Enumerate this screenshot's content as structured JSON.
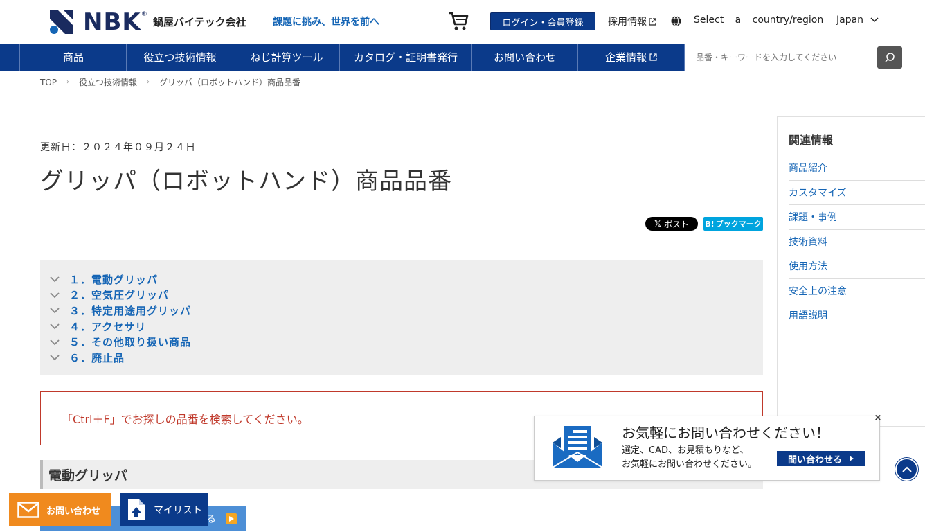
{
  "header": {
    "brand": "NBK",
    "company": "鍋屋バイテック会社",
    "tagline": "課題に挑み、世界を前へ",
    "login_label": "ログイン・会員登録",
    "recruit_label": "採用情報",
    "country_prompt": "Select a country/region",
    "country_value": "Japan"
  },
  "nav": {
    "items": [
      {
        "label": "商品"
      },
      {
        "label": "役立つ技術情報"
      },
      {
        "label": "ねじ計算ツール"
      },
      {
        "label": "カタログ・証明書発行"
      },
      {
        "label": "お問い合わせ"
      },
      {
        "label": "企業情報"
      }
    ],
    "search_placeholder": "品番・キーワードを入力してください"
  },
  "breadcrumb": [
    "TOP",
    "役立つ技術情報",
    "グリッパ（ロボットハンド）商品品番"
  ],
  "main": {
    "updated": "更新日：２０２４年０９月２４日",
    "title": "グリッパ（ロボットハンド）商品品番",
    "share_x": "ポスト",
    "share_hatena": "ブックマーク",
    "toc": [
      "１．電動グリッパ",
      "２．空気圧グリッパ",
      "３．特定用途用グリッパ",
      "４．アクセサリ",
      "５．その他取り扱い商品",
      "６．廃止品"
    ],
    "notice": "「Ctrl＋F」でお探しの品番を検索してください。",
    "section_title": "電動グリッパ",
    "section_link": "る"
  },
  "sidebar": {
    "title": "関連情報",
    "items": [
      "商品紹介",
      "カスタマイズ",
      "課題・事例",
      "技術資料",
      "使用方法",
      "安全上の注意",
      "用語説明"
    ]
  },
  "popup": {
    "title": "お気軽にお問い合わせください！",
    "body_line1": "選定、CAD、お見積もりなど、",
    "body_line2": "お気軽にお問い合わせください。",
    "button": "問い合わせる",
    "close": "×"
  },
  "floating": {
    "contact": "お問い合わせ",
    "mylist": "マイリスト"
  },
  "colors": {
    "brand_navy": "#0b3a8a",
    "link_blue": "#1565b5",
    "notice_red": "#c0392b",
    "contact_orange": "#f08a1e"
  }
}
